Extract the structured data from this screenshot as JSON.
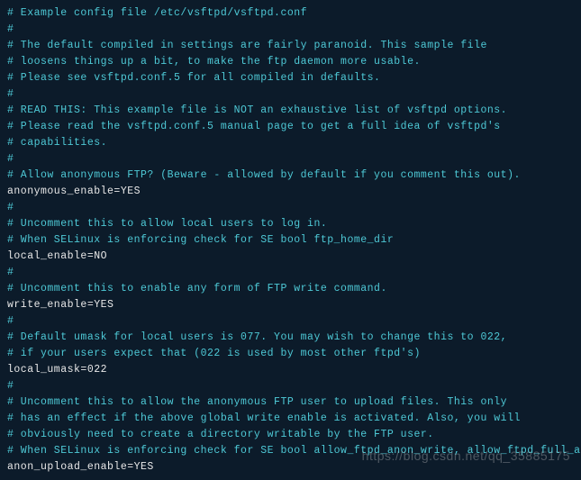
{
  "lines": [
    {
      "text": "# Example config file /etc/vsftpd/vsftpd.conf",
      "type": "comment"
    },
    {
      "text": "#",
      "type": "comment"
    },
    {
      "text": "# The default compiled in settings are fairly paranoid. This sample file",
      "type": "comment"
    },
    {
      "text": "# loosens things up a bit, to make the ftp daemon more usable.",
      "type": "comment"
    },
    {
      "text": "# Please see vsftpd.conf.5 for all compiled in defaults.",
      "type": "comment"
    },
    {
      "text": "#",
      "type": "comment"
    },
    {
      "text": "# READ THIS: This example file is NOT an exhaustive list of vsftpd options.",
      "type": "comment"
    },
    {
      "text": "# Please read the vsftpd.conf.5 manual page to get a full idea of vsftpd's",
      "type": "comment"
    },
    {
      "text": "# capabilities.",
      "type": "comment"
    },
    {
      "text": "#",
      "type": "comment"
    },
    {
      "text": "# Allow anonymous FTP? (Beware - allowed by default if you comment this out).",
      "type": "comment"
    },
    {
      "text": "anonymous_enable=YES",
      "type": "setting"
    },
    {
      "text": "#",
      "type": "comment"
    },
    {
      "text": "# Uncomment this to allow local users to log in.",
      "type": "comment"
    },
    {
      "text": "# When SELinux is enforcing check for SE bool ftp_home_dir",
      "type": "comment"
    },
    {
      "text": "local_enable=NO",
      "type": "setting"
    },
    {
      "text": "#",
      "type": "comment"
    },
    {
      "text": "# Uncomment this to enable any form of FTP write command.",
      "type": "comment"
    },
    {
      "text": "write_enable=YES",
      "type": "setting"
    },
    {
      "text": "#",
      "type": "comment"
    },
    {
      "text": "# Default umask for local users is 077. You may wish to change this to 022,",
      "type": "comment"
    },
    {
      "text": "# if your users expect that (022 is used by most other ftpd's)",
      "type": "comment"
    },
    {
      "text": "local_umask=022",
      "type": "setting"
    },
    {
      "text": "#",
      "type": "comment"
    },
    {
      "text": "# Uncomment this to allow the anonymous FTP user to upload files. This only",
      "type": "comment"
    },
    {
      "text": "# has an effect if the above global write enable is activated. Also, you will",
      "type": "comment"
    },
    {
      "text": "# obviously need to create a directory writable by the FTP user.",
      "type": "comment"
    },
    {
      "text": "# When SELinux is enforcing check for SE bool allow_ftpd_anon_write, allow_ftpd_full_access",
      "type": "comment"
    },
    {
      "text": "anon_upload_enable=YES",
      "type": "setting"
    }
  ],
  "watermark": "https://blog.csdn.net/qq_35885175"
}
